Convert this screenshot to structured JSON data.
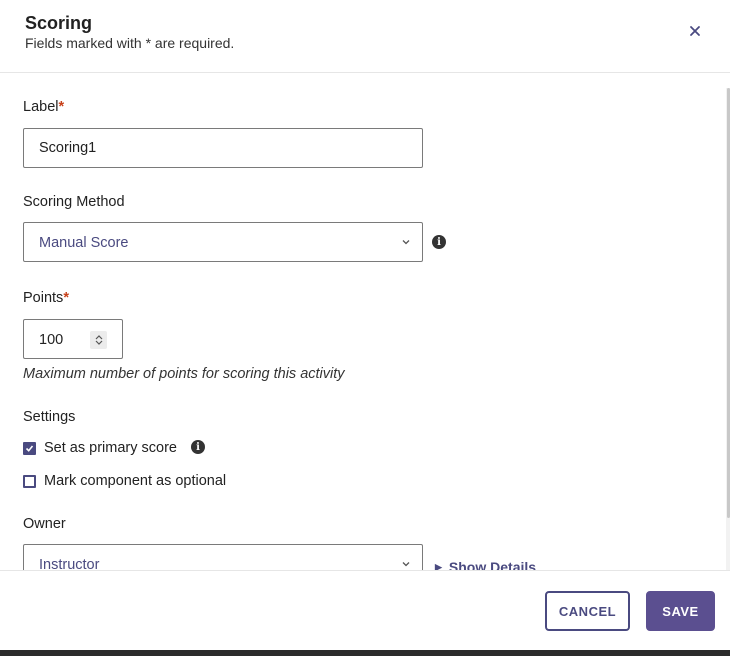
{
  "header": {
    "title": "Scoring",
    "subtitle": "Fields marked with * are required."
  },
  "form": {
    "label_field": {
      "label": "Label",
      "required_mark": "*",
      "value": "Scoring1"
    },
    "scoring_method": {
      "label": "Scoring Method",
      "value": "Manual Score"
    },
    "points": {
      "label": "Points",
      "required_mark": "*",
      "value": "100",
      "hint": "Maximum number of points for scoring this activity"
    },
    "settings": {
      "label": "Settings",
      "primary_score": {
        "label": "Set as primary score",
        "checked": true
      },
      "optional": {
        "label": "Mark component as optional",
        "checked": false
      }
    },
    "owner": {
      "label": "Owner",
      "value": "Instructor",
      "show_details": "Show Details"
    }
  },
  "footer": {
    "cancel_label": "CANCEL",
    "save_label": "SAVE"
  },
  "colors": {
    "accent": "#4a4a80",
    "save_bg": "#5b4f90",
    "required": "#c7401a"
  }
}
